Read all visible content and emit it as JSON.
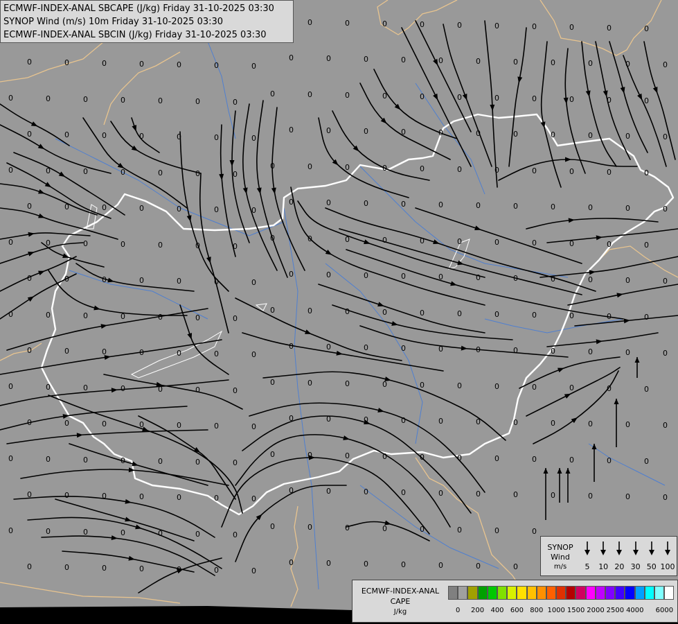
{
  "header": {
    "line1": "ECMWF-INDEX-ANAL SBCAPE (J/kg) Friday 31-10-2025 03:30",
    "line2": "SYNOP Wind (m/s) 10m Friday 31-10-2025 03:30",
    "line3": "ECMWF-INDEX-ANAL SBCIN (J/kg) Friday 31-10-2025 03:30"
  },
  "map": {
    "background_color": "#999999",
    "border_color": "#e8c48f",
    "country_outline_color": "#ffffff",
    "river_color": "#4f7fd0",
    "streamline_color": "#000000",
    "value_label": "0",
    "value_label_count": 300
  },
  "synop_legend": {
    "title_line1": "SYNOP",
    "title_line2": "Wind",
    "title_line3": "m/s",
    "speeds": [
      "5",
      "10",
      "20",
      "30",
      "50",
      "100"
    ]
  },
  "cape_legend": {
    "title_line1": "ECMWF-INDEX-ANAL",
    "title_line2": "CAPE",
    "unit": "J/kg",
    "colors": [
      "#808080",
      "#a0a0a0",
      "#a0a000",
      "#00a000",
      "#00c800",
      "#80e000",
      "#d8f000",
      "#ffe000",
      "#ffc000",
      "#ff9000",
      "#ff6000",
      "#e03000",
      "#b40000",
      "#d00060",
      "#ff00ff",
      "#c000ff",
      "#8000ff",
      "#4000ff",
      "#0000ff",
      "#00a0ff",
      "#00ffff",
      "#80ffff",
      "#ffffff"
    ],
    "ticks": [
      "0",
      "200",
      "400",
      "600",
      "800",
      "1000",
      "1500",
      "2000",
      "2500",
      "4000",
      "6000"
    ]
  }
}
